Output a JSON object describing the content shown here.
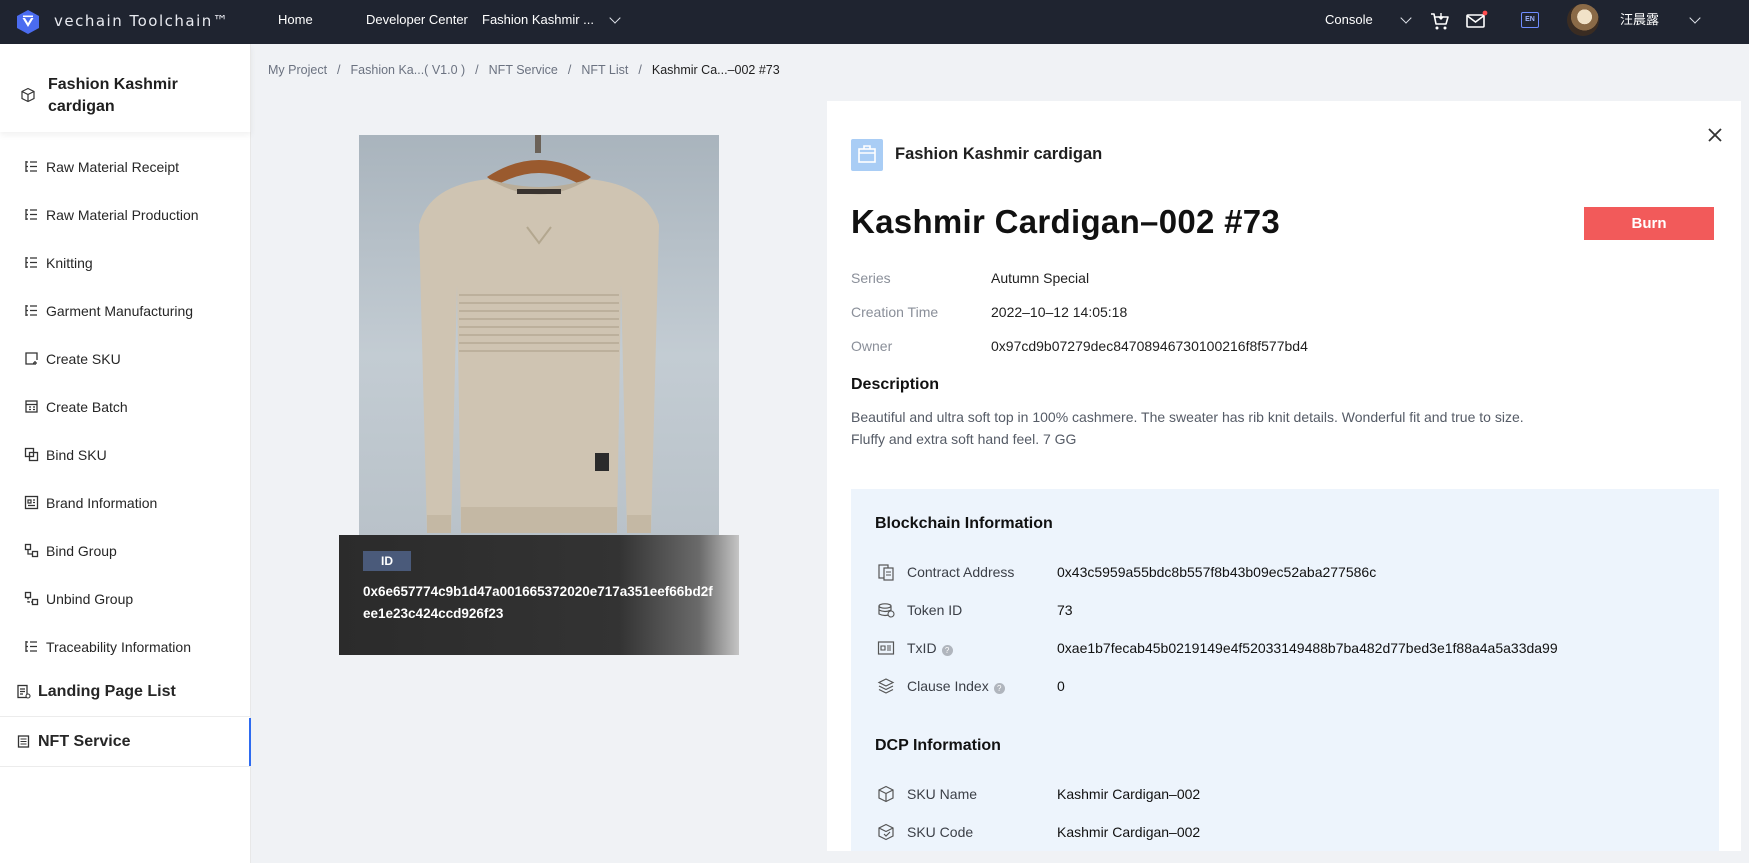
{
  "header": {
    "brand": "vechain Toolchain™",
    "nav": {
      "home": "Home",
      "developer_center": "Developer Center",
      "project_selector": "Fashion Kashmir ...",
      "console": "Console"
    },
    "language_badge": "EN",
    "username": "汪晨露"
  },
  "sidebar": {
    "project_name": "Fashion Kashmir cardigan",
    "items": [
      {
        "label": "Raw Material Receipt"
      },
      {
        "label": "Raw Material Production"
      },
      {
        "label": "Knitting"
      },
      {
        "label": "Garment Manufacturing"
      },
      {
        "label": "Create SKU"
      },
      {
        "label": "Create Batch"
      },
      {
        "label": "Bind SKU"
      },
      {
        "label": "Brand Information"
      },
      {
        "label": "Bind Group"
      },
      {
        "label": "Unbind Group"
      },
      {
        "label": "Traceability Information"
      }
    ],
    "landing_page_list": "Landing Page List",
    "nft_service": "NFT Service"
  },
  "breadcrumb": {
    "items": [
      "My Project",
      "Fashion Ka...( V1.0 )",
      "NFT Service",
      "NFT List"
    ],
    "current": "Kashmir Ca...–002 #73"
  },
  "nft_card": {
    "id_label": "ID",
    "id_value": "0x6e657774c9b1d47a001665372020e717a351eef66bd2fee1e23c424ccd926f23"
  },
  "detail": {
    "collection_name": "Fashion Kashmir cardigan",
    "title": "Kashmir Cardigan–002 #73",
    "burn_label": "Burn",
    "series_label": "Series",
    "series_value": "Autumn Special",
    "creation_time_label": "Creation Time",
    "creation_time_value": "2022–10–12 14:05:18",
    "owner_label": "Owner",
    "owner_value": "0x97cd9b07279dec84708946730100216f8f577bd4",
    "description_title": "Description",
    "description_text": "Beautiful and ultra soft top in 100% cashmere. The sweater has rib knit details. Wonderful fit and true to size. Fluffy and extra soft hand feel. 7 GG"
  },
  "blockchain": {
    "title": "Blockchain Information",
    "contract_address_label": "Contract Address",
    "contract_address_value": "0x43c5959a55bdc8b557f8b43b09ec52aba277586c",
    "token_id_label": "Token ID",
    "token_id_value": "73",
    "txid_label": "TxID",
    "txid_value": "0xae1b7fecab45b0219149e4f52033149488b7ba482d77bed3e1f88a4a5a33da99",
    "clause_index_label": "Clause Index",
    "clause_index_value": "0"
  },
  "dcp": {
    "title": "DCP Information",
    "sku_name_label": "SKU Name",
    "sku_name_value": "Kashmir Cardigan–002",
    "sku_code_label": "SKU Code",
    "sku_code_value": "Kashmir Cardigan–002"
  },
  "colors": {
    "topbar": "#1f2430",
    "accent": "#2e6bf0",
    "burn": "#f25a5a",
    "chain_box": "#edf4fc"
  }
}
